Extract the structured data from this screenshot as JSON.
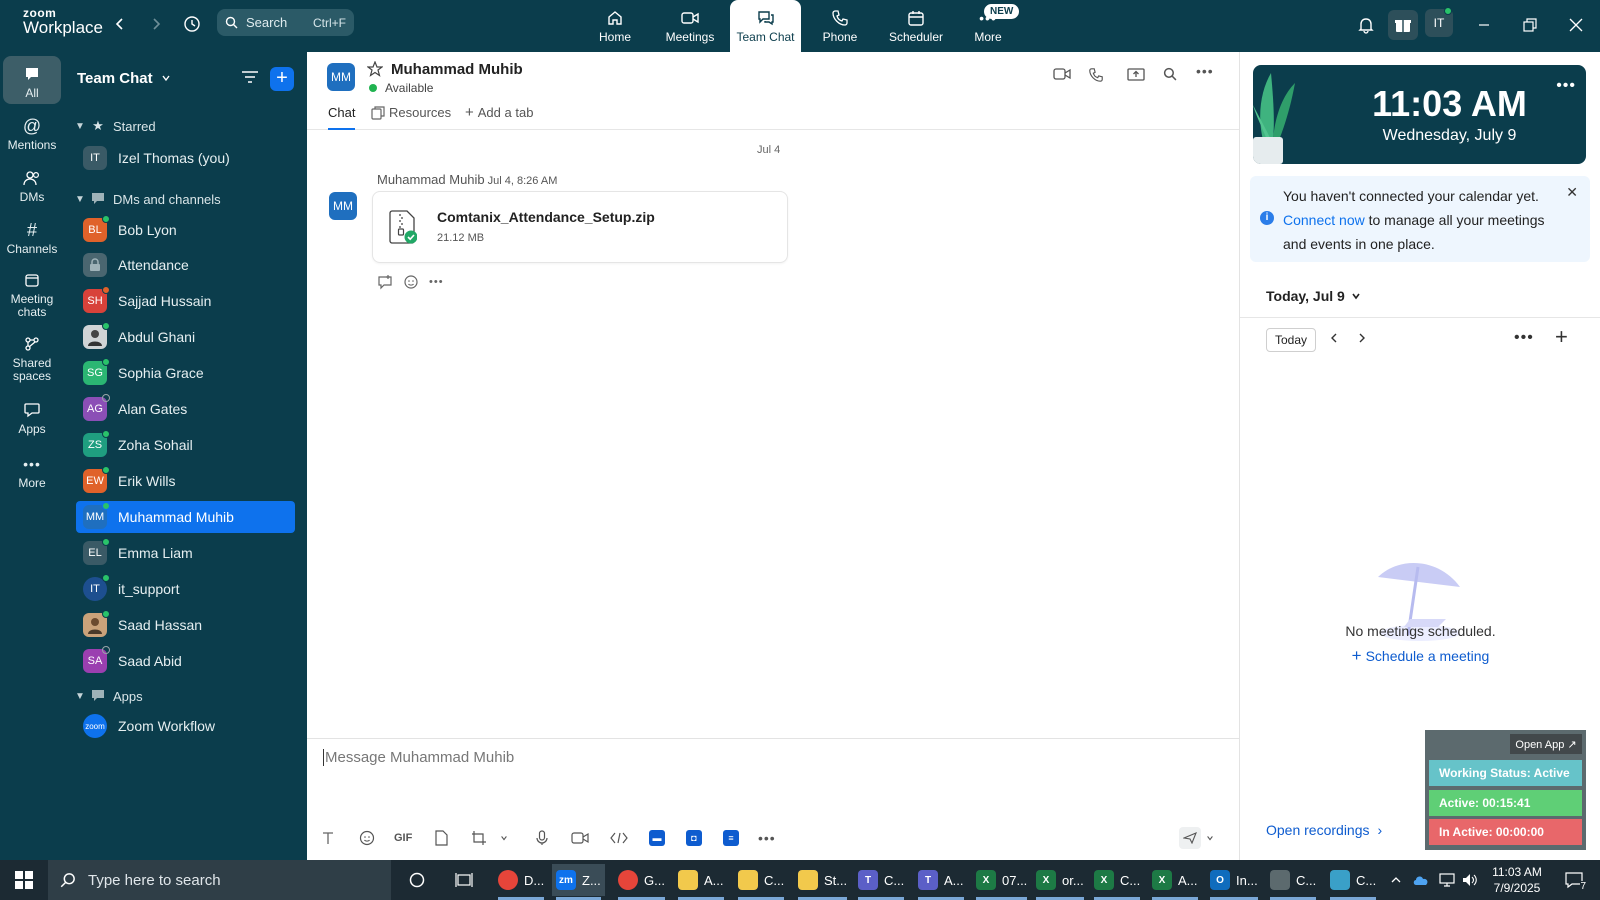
{
  "app": {
    "logo_line1": "zoom",
    "logo_line2": "Workplace",
    "search_label": "Search",
    "search_shortcut": "Ctrl+F",
    "nav": [
      {
        "id": "home",
        "label": "Home",
        "icon": "home-icon"
      },
      {
        "id": "meetings",
        "label": "Meetings",
        "icon": "video-icon"
      },
      {
        "id": "team-chat",
        "label": "Team Chat",
        "icon": "chat-icon",
        "active": true
      },
      {
        "id": "phone",
        "label": "Phone",
        "icon": "phone-icon"
      },
      {
        "id": "scheduler",
        "label": "Scheduler",
        "icon": "calendar-icon"
      },
      {
        "id": "more",
        "label": "More",
        "icon": "more-icon",
        "badge": "NEW"
      }
    ],
    "user_initials": "IT"
  },
  "rail": [
    {
      "id": "all",
      "label": "All",
      "icon": "chat-bubble-icon",
      "active": true
    },
    {
      "id": "mentions",
      "label": "Mentions",
      "icon": "at-icon"
    },
    {
      "id": "dms",
      "label": "DMs",
      "icon": "people-icon"
    },
    {
      "id": "channels",
      "label": "Channels",
      "icon": "hash-icon"
    },
    {
      "id": "meeting-chats",
      "label": "Meeting chats",
      "icon": "calendar-chat-icon"
    },
    {
      "id": "shared-spaces",
      "label": "Shared spaces",
      "icon": "share-icon"
    },
    {
      "id": "apps",
      "label": "Apps",
      "icon": "apps-icon"
    },
    {
      "id": "more",
      "label": "More",
      "icon": "ellipsis-icon"
    }
  ],
  "sidebar": {
    "title": "Team Chat",
    "sections": {
      "starred": "Starred",
      "dms": "DMs and channels",
      "apps": "Apps"
    },
    "starred": [
      {
        "name": "Izel Thomas (you)",
        "initials": "IT",
        "color": "#3a5a66"
      }
    ],
    "items": [
      {
        "name": "Bob Lyon",
        "initials": "BL",
        "color": "#e0622a",
        "status": "#29c36a"
      },
      {
        "name": "Attendance",
        "initials": "",
        "color": "#4a6670",
        "lock": true
      },
      {
        "name": "Sajjad Hussain",
        "initials": "SH",
        "color": "#d8423a",
        "status": "#e0622a"
      },
      {
        "name": "Abdul Ghani",
        "initials": "",
        "color": "#d0d4d6",
        "photo": true,
        "status": "#29c36a"
      },
      {
        "name": "Sophia Grace",
        "initials": "SG",
        "color": "#2bb673",
        "status": "#29c36a"
      },
      {
        "name": "Alan Gates",
        "initials": "AG",
        "color": "#8b4fb6",
        "status": "#9aa5a9"
      },
      {
        "name": "Zoha Sohail",
        "initials": "ZS",
        "color": "#1f9e80",
        "status": "#29c36a"
      },
      {
        "name": "Erik Wills",
        "initials": "EW",
        "color": "#e0622a",
        "status": "#29c36a"
      },
      {
        "name": "Muhammad Muhib",
        "initials": "MM",
        "color": "#1f6fbf",
        "status": "#29c36a",
        "selected": true
      },
      {
        "name": "Emma Liam",
        "initials": "EL",
        "color": "#3a5a66",
        "status": "#29c36a"
      },
      {
        "name": "it_support",
        "initials": "IT",
        "color": "#1d4f8f",
        "status": "#29c36a"
      },
      {
        "name": "Saad Hassan",
        "initials": "",
        "color": "#caa27a",
        "photo": true,
        "status": "#29c36a"
      },
      {
        "name": "Saad Abid",
        "initials": "SA",
        "color": "#9b3fb0",
        "status": "#9aa5a9"
      }
    ],
    "apps": [
      {
        "name": "Zoom Workflow",
        "initials": "zoom",
        "color": "#0e72ed"
      }
    ]
  },
  "chat": {
    "contact_initials": "MM",
    "contact_name": "Muhammad Muhib",
    "contact_status": "Available",
    "tabs": [
      {
        "label": "Chat",
        "active": true
      },
      {
        "label": "Resources"
      },
      {
        "label": "Add a tab"
      }
    ],
    "date_separator": "Jul 4",
    "message": {
      "sender": "Muhammad Muhib",
      "time": "Jul 4, 8:26 AM",
      "file_name": "Comtanix_Attendance_Setup.zip",
      "file_size": "21.12 MB"
    },
    "composer_placeholder": "Message Muhammad Muhib",
    "composer_tools": [
      "text-format-icon",
      "emoji-icon",
      "gif-icon",
      "file-icon",
      "screenshot-icon",
      "microphone-icon",
      "video-clip-icon",
      "code-icon",
      "app-icon-1",
      "app-icon-2",
      "app-icon-3",
      "more-icon"
    ],
    "gif_label": "GIF"
  },
  "calendar": {
    "time": "11:03 AM",
    "date": "Wednesday, July 9",
    "notice_pre": "You haven't connected your calendar yet.",
    "notice_link": "Connect now",
    "notice_post": "to manage all your meetings and events in one place.",
    "today_header": "Today, Jul 9",
    "today_button": "Today",
    "no_meetings": "No meetings scheduled.",
    "schedule_link": "Schedule a meeting",
    "open_recordings": "Open recordings"
  },
  "widget": {
    "open_app": "Open App ↗",
    "working_status": "Working Status: Active",
    "active": "Active: 00:15:41",
    "inactive": "In Active: 00:00:00",
    "colors": {
      "working": "#66c3c9",
      "active": "#5fcf76",
      "inactive": "#e8676a"
    }
  },
  "taskbar": {
    "search_placeholder": "Type here to search",
    "apps": [
      {
        "label": "D...",
        "icon": "chrome-icon",
        "color": "#e6453a"
      },
      {
        "label": "Z...",
        "icon": "zoom-icon",
        "color": "#0e72ed",
        "active": true
      },
      {
        "label": "G...",
        "icon": "chrome-icon",
        "color": "#e6453a"
      },
      {
        "label": "A...",
        "icon": "folder-icon",
        "color": "#f2c94c"
      },
      {
        "label": "C...",
        "icon": "folder-icon",
        "color": "#f2c94c"
      },
      {
        "label": "St...",
        "icon": "folder-icon",
        "color": "#f2c94c"
      },
      {
        "label": "C...",
        "icon": "teams-icon",
        "color": "#5b5fc7"
      },
      {
        "label": "A...",
        "icon": "teams-icon",
        "color": "#5b5fc7"
      },
      {
        "label": "07...",
        "icon": "excel-icon",
        "color": "#1d7a45"
      },
      {
        "label": "or...",
        "icon": "excel-icon",
        "color": "#1d7a45"
      },
      {
        "label": "C...",
        "icon": "excel-icon",
        "color": "#1d7a45"
      },
      {
        "label": "A...",
        "icon": "excel-icon",
        "color": "#1d7a45"
      },
      {
        "label": "In...",
        "icon": "outlook-icon",
        "color": "#0f6cbd"
      },
      {
        "label": "C...",
        "icon": "app-icon",
        "color": "#5c6a6e"
      },
      {
        "label": "C...",
        "icon": "app-icon",
        "color": "#3aa0c8"
      }
    ],
    "time": "11:03 AM",
    "date": "7/9/2025",
    "notification_count": "7"
  }
}
